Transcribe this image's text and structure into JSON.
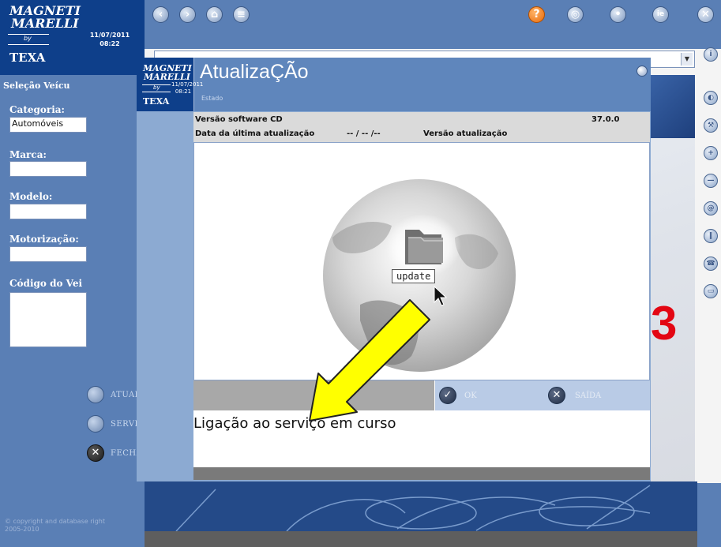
{
  "brand": {
    "logo_top": "MAGNETI",
    "logo_bottom": "MARELLI",
    "by": "by",
    "texa": "TEXA",
    "date": "11/07/2011",
    "time": "08:22"
  },
  "popup_brand": {
    "logo_top": "MAGNETI",
    "logo_bottom": "MARELLI",
    "by": "by",
    "texa": "TEXA",
    "date": "11/07/2011",
    "time": "08:21"
  },
  "sidebar": {
    "title": "Seleção Veícu",
    "fields": [
      {
        "label": "Categoria:",
        "value": "Automóveis"
      },
      {
        "label": "Marca:",
        "value": ""
      },
      {
        "label": "Modelo:",
        "value": ""
      },
      {
        "label": "Motorização:",
        "value": ""
      },
      {
        "label": "Código do Vei",
        "value": ""
      }
    ],
    "buttons": [
      {
        "label": "ATUALIZAR",
        "icon": "update-icon"
      },
      {
        "label": "SERVIÇO",
        "icon": "service-icon"
      },
      {
        "label": "FECHAR",
        "icon": "close-icon"
      }
    ],
    "copyright": "© copyright and database right 2005-2010"
  },
  "toolbar": {
    "back": "back-icon",
    "forward": "forward-icon",
    "home": "home-icon",
    "refresh": "refresh-icon",
    "help": "?",
    "tool1": "web-icon",
    "tool2": "user-icon",
    "tool3": "ie-icon",
    "close": "close-icon"
  },
  "dialog": {
    "title": "AtualizaÇÃo",
    "subtitle": "Estado",
    "version_label": "Versão software CD",
    "version_value": "37.0.0",
    "last_update_label": "Data da última atualização",
    "last_update_value": "-- / -- /--",
    "update_version_label": "Versão atualização",
    "folder_label": "update",
    "ok_label": "OK",
    "exit_label": "SAÍDA",
    "message": "Ligação ao serviço em curso"
  },
  "colors": {
    "sidebar": "#5a7fb5",
    "brand": "#0e3f8a",
    "arrow": "#ffff00",
    "accent_red": "#e30613"
  }
}
